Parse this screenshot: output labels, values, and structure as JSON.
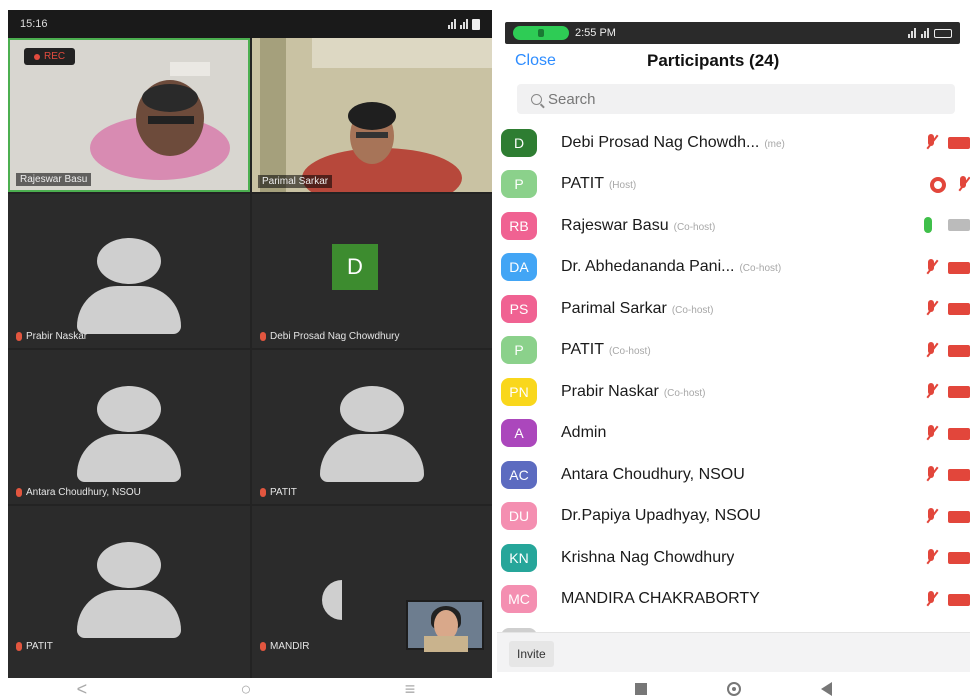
{
  "left_phone": {
    "status_time": "15:16",
    "rec_label": "REC",
    "tiles": [
      {
        "name": "Rajeswar Basu",
        "type": "video"
      },
      {
        "name": "Parimal Sarkar",
        "type": "video"
      },
      {
        "name": "Prabir Naskar",
        "type": "avatar"
      },
      {
        "name": "Debi Prosad Nag Chowdhury",
        "type": "initial",
        "initial": "D"
      },
      {
        "name": "Antara Choudhury, NSOU",
        "type": "avatar"
      },
      {
        "name": "PATIT",
        "type": "avatar"
      },
      {
        "name": "PATIT",
        "type": "avatar"
      },
      {
        "name": "MANDIR",
        "type": "avatar"
      }
    ],
    "nav": {
      "back": "<",
      "home": "○",
      "recents": "≡"
    }
  },
  "right_phone": {
    "status_time": "2:55 PM",
    "header": {
      "close_label": "Close",
      "title": "Participants (24)"
    },
    "search": {
      "placeholder": "Search"
    },
    "participants": [
      {
        "initials": "D",
        "name": "Debi Prosad Nag Chowdh...",
        "role": "(me)",
        "color": "#2e7d32",
        "mic": "muted",
        "cam": "off"
      },
      {
        "initials": "P",
        "name": "PATIT",
        "role": "(Host)",
        "color": "#8bd18b",
        "mic": "muted",
        "cam": "screen"
      },
      {
        "initials": "RB",
        "name": "Rajeswar Basu",
        "role": "(Co-host)",
        "color": "#f06292",
        "mic": "on",
        "cam": "on"
      },
      {
        "initials": "DA",
        "name": "Dr. Abhedananda Pani...",
        "role": "(Co-host)",
        "color": "#42a5f5",
        "mic": "muted",
        "cam": "off"
      },
      {
        "initials": "PS",
        "name": "Parimal Sarkar",
        "role": "(Co-host)",
        "color": "#f06292",
        "mic": "muted",
        "cam": "off"
      },
      {
        "initials": "P",
        "name": "PATIT",
        "role": "(Co-host)",
        "color": "#8bd18b",
        "mic": "muted",
        "cam": "off"
      },
      {
        "initials": "PN",
        "name": "Prabir Naskar",
        "role": "(Co-host)",
        "color": "#f9d71c",
        "mic": "muted",
        "cam": "off"
      },
      {
        "initials": "A",
        "name": "Admin",
        "role": "",
        "color": "#ab47bc",
        "mic": "muted",
        "cam": "off"
      },
      {
        "initials": "AC",
        "name": "Antara Choudhury, NSOU",
        "role": "",
        "color": "#5c6bc0",
        "mic": "muted",
        "cam": "off"
      },
      {
        "initials": "DU",
        "name": "Dr.Papiya Upadhyay, NSOU",
        "role": "",
        "color": "#f48fb1",
        "mic": "muted",
        "cam": "off"
      },
      {
        "initials": "KN",
        "name": "Krishna Nag Chowdhury",
        "role": "",
        "color": "#26a69a",
        "mic": "muted",
        "cam": "off"
      },
      {
        "initials": "MC",
        "name": "MANDIRA CHAKRABORTY",
        "role": "",
        "color": "#f48fb1",
        "mic": "muted",
        "cam": "off"
      }
    ],
    "invite_label": "Invite"
  }
}
